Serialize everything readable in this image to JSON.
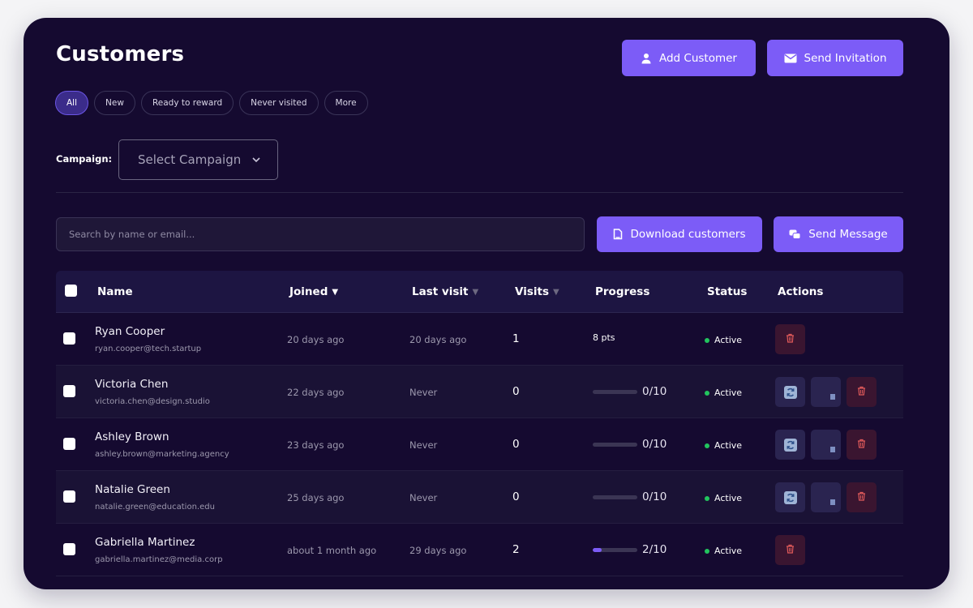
{
  "header": {
    "title": "Customers",
    "add_customer_label": "Add Customer",
    "send_invitation_label": "Send Invitation"
  },
  "filters": [
    "All",
    "New",
    "Ready to reward",
    "Never visited",
    "More"
  ],
  "active_filter": "All",
  "campaign": {
    "label": "Campaign:",
    "placeholder": "Select Campaign"
  },
  "search": {
    "placeholder": "Search by name or email..."
  },
  "toolbar": {
    "download_label": "Download customers",
    "message_label": "Send Message"
  },
  "table": {
    "columns": {
      "name": "Name",
      "joined": "Joined",
      "last_visit": "Last visit",
      "visits": "Visits",
      "progress": "Progress",
      "status": "Status",
      "actions": "Actions"
    },
    "sort_caret": "▼",
    "rows": [
      {
        "name": "Ryan Cooper",
        "email": "ryan.cooper@tech.startup",
        "joined": "20 days ago",
        "last_visit": "20 days ago",
        "visits": "1",
        "progress_text": "8 pts",
        "progress_fraction": null,
        "status": "Active",
        "actions": [
          "delete"
        ]
      },
      {
        "name": "Victoria Chen",
        "email": "victoria.chen@design.studio",
        "joined": "22 days ago",
        "last_visit": "Never",
        "visits": "0",
        "progress_text": "0/10",
        "progress_fraction": 0,
        "status": "Active",
        "actions": [
          "sync",
          "mail",
          "delete"
        ]
      },
      {
        "name": "Ashley Brown",
        "email": "ashley.brown@marketing.agency",
        "joined": "23 days ago",
        "last_visit": "Never",
        "visits": "0",
        "progress_text": "0/10",
        "progress_fraction": 0,
        "status": "Active",
        "actions": [
          "sync",
          "mail",
          "delete"
        ]
      },
      {
        "name": "Natalie Green",
        "email": "natalie.green@education.edu",
        "joined": "25 days ago",
        "last_visit": "Never",
        "visits": "0",
        "progress_text": "0/10",
        "progress_fraction": 0,
        "status": "Active",
        "actions": [
          "sync",
          "mail",
          "delete"
        ]
      },
      {
        "name": "Gabriella Martinez",
        "email": "gabriella.martinez@media.corp",
        "joined": "about 1 month ago",
        "last_visit": "29 days ago",
        "visits": "2",
        "progress_text": "2/10",
        "progress_fraction": 0.2,
        "status": "Active",
        "actions": [
          "delete"
        ]
      }
    ]
  },
  "colors": {
    "background": "#150a30",
    "accent": "#7c5cf7",
    "status_active": "#22c55e",
    "delete": "#e05a5a"
  }
}
